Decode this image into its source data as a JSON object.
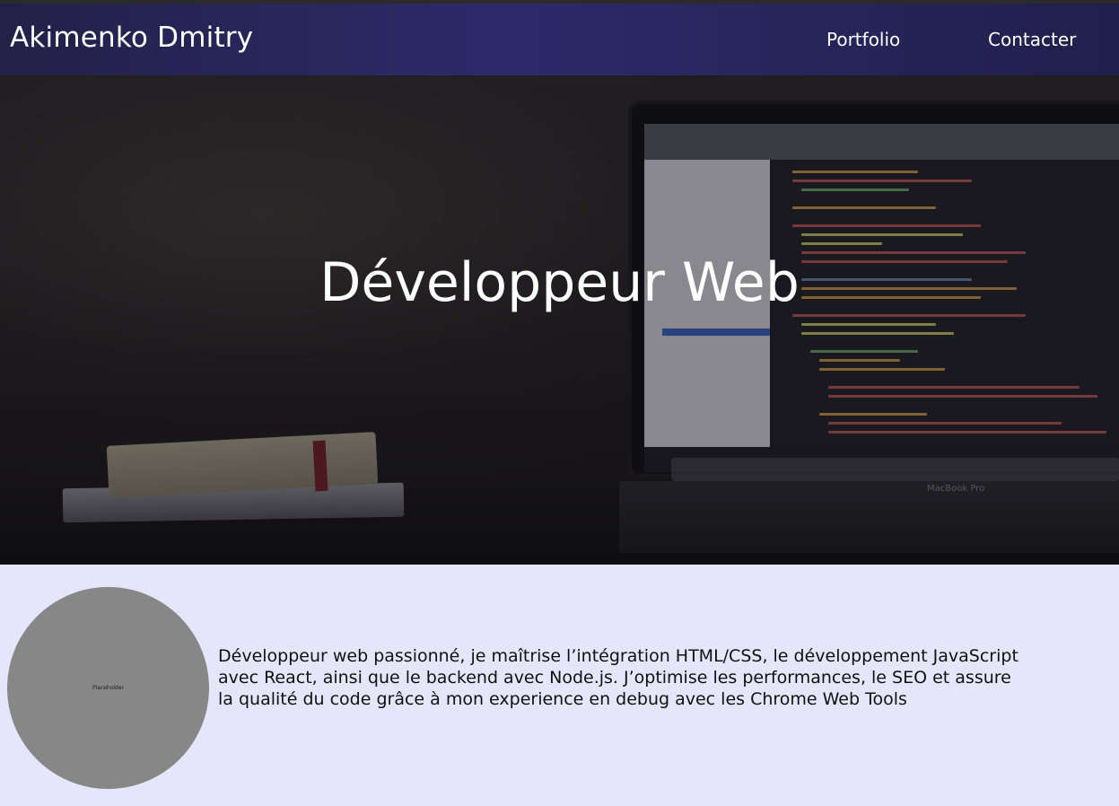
{
  "header": {
    "brand": "Akimenko Dmitry",
    "nav": [
      {
        "label": "Portfolio"
      },
      {
        "label": "Contacter"
      }
    ]
  },
  "hero": {
    "title": "Développeur Web",
    "laptop_label": "MacBook Pro"
  },
  "about": {
    "avatar_placeholder": "Placeholder",
    "text": "Développeur web passionné, je maîtrise l’intégration HTML/CSS, le développement JavaScript avec React, ainsi que le backend avec Node.js. J’optimise les performances, le SEO et assure la qualité du code grâce à mon experience en debug avec les Chrome Web Tools"
  },
  "colors": {
    "navbar": "#2d2a6a",
    "page_background": "#e6e6fa",
    "avatar": "#878787"
  }
}
